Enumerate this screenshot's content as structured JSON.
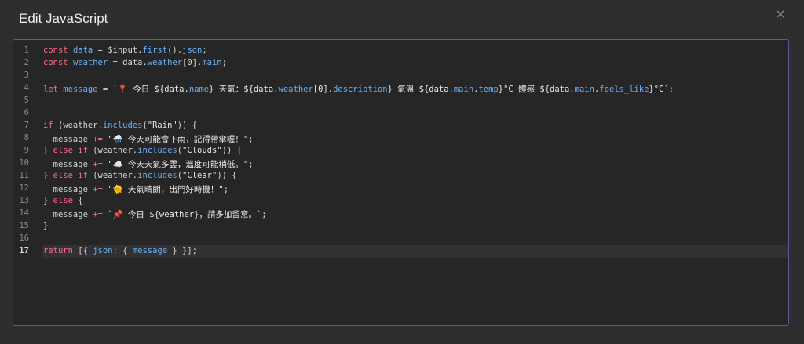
{
  "dialog": {
    "title": "Edit JavaScript",
    "close_glyph": "×"
  },
  "editor": {
    "active_line": 17,
    "lines": [
      {
        "n": "1",
        "tokens": [
          [
            "kw",
            "const "
          ],
          [
            "prop",
            "data"
          ],
          [
            "punc",
            " = "
          ],
          [
            "punc",
            "$input."
          ],
          [
            "prop",
            "first"
          ],
          [
            "punc",
            "()."
          ],
          [
            "prop",
            "json"
          ],
          [
            "punc",
            ";"
          ]
        ]
      },
      {
        "n": "2",
        "tokens": [
          [
            "kw",
            "const "
          ],
          [
            "prop",
            "weather"
          ],
          [
            "punc",
            " = data."
          ],
          [
            "prop",
            "weather"
          ],
          [
            "punc",
            "[0]."
          ],
          [
            "prop",
            "main"
          ],
          [
            "punc",
            ";"
          ]
        ]
      },
      {
        "n": "3",
        "tokens": []
      },
      {
        "n": "4",
        "tokens": [
          [
            "kw",
            "let "
          ],
          [
            "prop",
            "message"
          ],
          [
            "punc",
            " = "
          ],
          [
            "tpl",
            "`📍 今日 ${data."
          ],
          [
            "prop",
            "name"
          ],
          [
            "tpl",
            "} 天氣：${data."
          ],
          [
            "prop",
            "weather"
          ],
          [
            "tpl",
            "[0]."
          ],
          [
            "prop",
            "description"
          ],
          [
            "tpl",
            "} 氣溫 ${data."
          ],
          [
            "prop",
            "main"
          ],
          [
            "tpl",
            "."
          ],
          [
            "prop",
            "temp"
          ],
          [
            "tpl",
            "}°C 體感 ${data."
          ],
          [
            "prop",
            "main"
          ],
          [
            "tpl",
            "."
          ],
          [
            "prop",
            "feels_like"
          ],
          [
            "tpl",
            "}°C`"
          ],
          [
            "punc",
            ";"
          ]
        ]
      },
      {
        "n": "5",
        "tokens": []
      },
      {
        "n": "6",
        "tokens": []
      },
      {
        "n": "7",
        "tokens": [
          [
            "kw",
            "if "
          ],
          [
            "punc",
            "(weather."
          ],
          [
            "prop",
            "includes"
          ],
          [
            "punc",
            "("
          ],
          [
            "str",
            "\"Rain\""
          ],
          [
            "punc",
            ")) {"
          ]
        ]
      },
      {
        "n": "8",
        "tokens": [
          [
            "punc",
            "  message "
          ],
          [
            "kw",
            "+= "
          ],
          [
            "str",
            "\"🌧️ 今天可能會下雨，記得帶傘喔！\""
          ],
          [
            "punc",
            ";"
          ]
        ]
      },
      {
        "n": "9",
        "tokens": [
          [
            "punc",
            "} "
          ],
          [
            "kw",
            "else if "
          ],
          [
            "punc",
            "(weather."
          ],
          [
            "prop",
            "includes"
          ],
          [
            "punc",
            "("
          ],
          [
            "str",
            "\"Clouds\""
          ],
          [
            "punc",
            ")) {"
          ]
        ]
      },
      {
        "n": "10",
        "tokens": [
          [
            "punc",
            "  message "
          ],
          [
            "kw",
            "+= "
          ],
          [
            "str",
            "\"☁️ 今天天氣多雲，溫度可能稍低。\""
          ],
          [
            "punc",
            ";"
          ]
        ]
      },
      {
        "n": "11",
        "tokens": [
          [
            "punc",
            "} "
          ],
          [
            "kw",
            "else if "
          ],
          [
            "punc",
            "(weather."
          ],
          [
            "prop",
            "includes"
          ],
          [
            "punc",
            "("
          ],
          [
            "str",
            "\"Clear\""
          ],
          [
            "punc",
            ")) {"
          ]
        ]
      },
      {
        "n": "12",
        "tokens": [
          [
            "punc",
            "  message "
          ],
          [
            "kw",
            "+= "
          ],
          [
            "str",
            "\"🌞 天氣晴朗，出門好時機！\""
          ],
          [
            "punc",
            ";"
          ]
        ]
      },
      {
        "n": "13",
        "tokens": [
          [
            "punc",
            "} "
          ],
          [
            "kw",
            "else "
          ],
          [
            "punc",
            "{"
          ]
        ]
      },
      {
        "n": "14",
        "tokens": [
          [
            "punc",
            "  message "
          ],
          [
            "kw",
            "+= "
          ],
          [
            "tpl",
            "`📌 今日 ${weather}，請多加留意。`"
          ],
          [
            "punc",
            ";"
          ]
        ]
      },
      {
        "n": "15",
        "tokens": [
          [
            "punc",
            "}"
          ]
        ]
      },
      {
        "n": "16",
        "tokens": []
      },
      {
        "n": "17",
        "tokens": [
          [
            "kw",
            "return "
          ],
          [
            "punc",
            "[{ "
          ],
          [
            "prop",
            "json"
          ],
          [
            "punc",
            ": { "
          ],
          [
            "prop",
            "message"
          ],
          [
            "punc",
            " } }];"
          ]
        ]
      }
    ]
  }
}
